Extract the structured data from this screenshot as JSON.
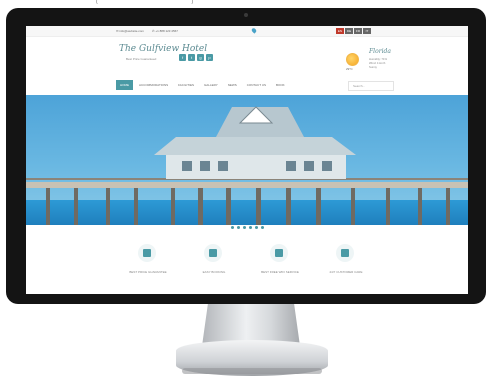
{
  "site": {
    "top_caption": "( _______________________ )",
    "utility": {
      "email": "✉ info@website.com",
      "phone": "✆ +1 888 123 4567",
      "languages": [
        "EN",
        "DE",
        "FR",
        "IT"
      ]
    },
    "logo": "The Gulfview Hotel",
    "tagline": "Best Price Guaranteed",
    "social": [
      "f",
      "t",
      "g",
      "p"
    ],
    "weather": {
      "city": "Florida",
      "temp": "29°C",
      "details": [
        "Humidity: 71%",
        "Wind: 4 km/h",
        "Sunny"
      ]
    },
    "nav": [
      {
        "label": "HOME",
        "active": true
      },
      {
        "label": "ACCOMMODATIONS",
        "active": false
      },
      {
        "label": "FACILITIES",
        "active": false
      },
      {
        "label": "GALLERY",
        "active": false
      },
      {
        "label": "NEWS",
        "active": false
      },
      {
        "label": "CONTACT US",
        "active": false
      },
      {
        "label": "BOOK",
        "active": false
      }
    ],
    "search_placeholder": "Search...",
    "slider_dots": 6,
    "features": [
      {
        "label": "BEST PRICE GUARANTEE",
        "icon": "hotel-icon"
      },
      {
        "label": "EASY BOOKING",
        "icon": "bed-icon"
      },
      {
        "label": "BEST FREE WIFI SERVICE",
        "icon": "wifi-icon"
      },
      {
        "label": "24/7 CUSTOMER CARE",
        "icon": "support-icon"
      }
    ]
  },
  "colors": {
    "accent": "#4a9aa5",
    "monitor_bezel": "#141414",
    "sky": "#5fb1df",
    "sea": "#1f7fbd"
  }
}
